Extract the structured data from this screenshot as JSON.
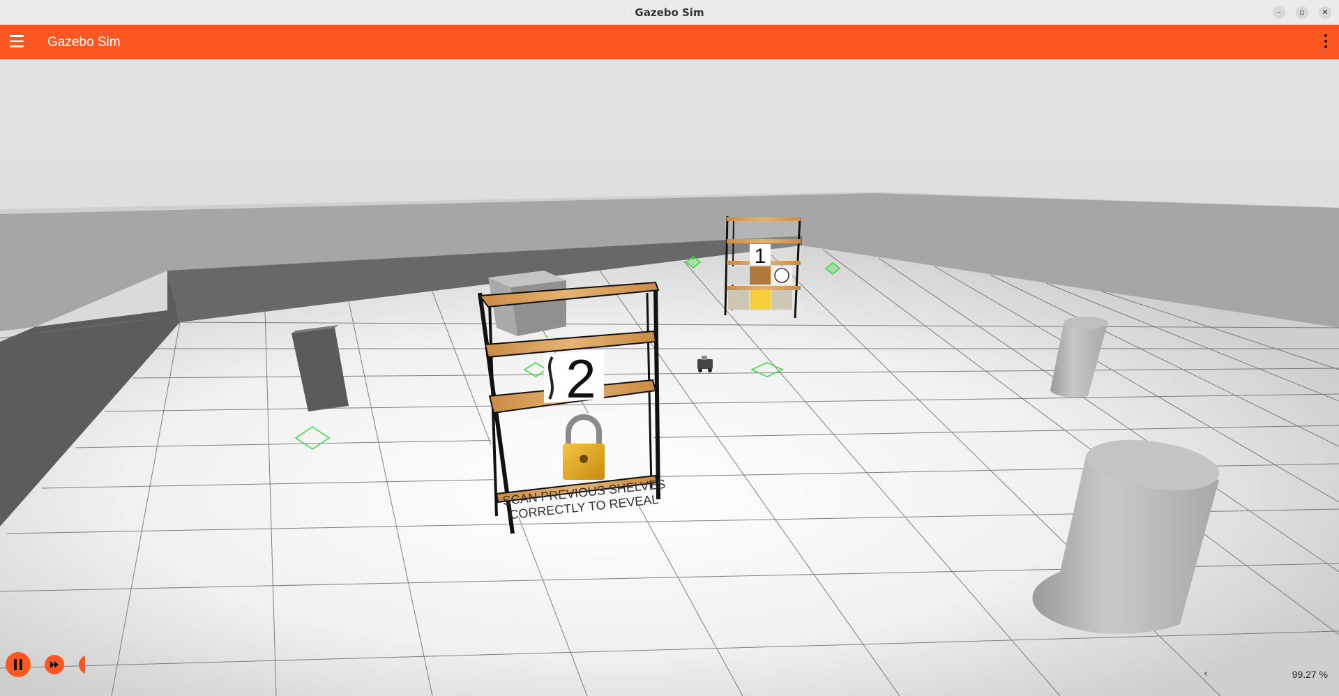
{
  "window": {
    "title": "Gazebo Sim"
  },
  "appbar": {
    "title": "Gazebo Sim"
  },
  "scene": {
    "shelf_near": {
      "number": "2",
      "lock_caption_line1": "SCAN PREVIOUS SHELVES",
      "lock_caption_line2": "CORRECTLY TO REVEAL"
    },
    "shelf_far": {
      "number": "1"
    }
  },
  "status": {
    "rtf": "99.27 %"
  },
  "colors": {
    "accent": "#ff5722",
    "wood": "#d9a05b",
    "marker": "#33dd33"
  }
}
